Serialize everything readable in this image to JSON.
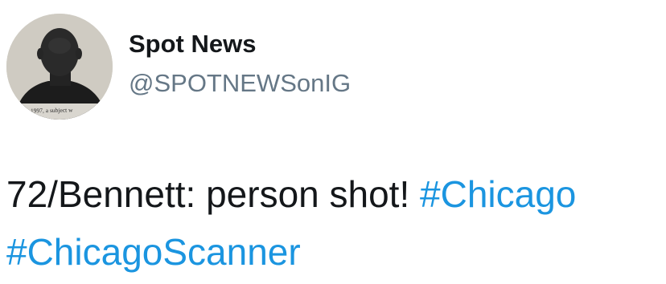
{
  "user": {
    "display_name": "Spot News",
    "handle": "@SPOTNEWSonIG",
    "avatar_icon": "profile-photo-icon",
    "avatar_caption": "1997, a subject w"
  },
  "tweet": {
    "text": "72/Bennett: person shot!",
    "hashtags": [
      "#Chicago",
      "#ChicagoScanner"
    ]
  },
  "colors": {
    "hashtag": "#1b95e0",
    "handle": "#657786",
    "text": "#14171a"
  }
}
